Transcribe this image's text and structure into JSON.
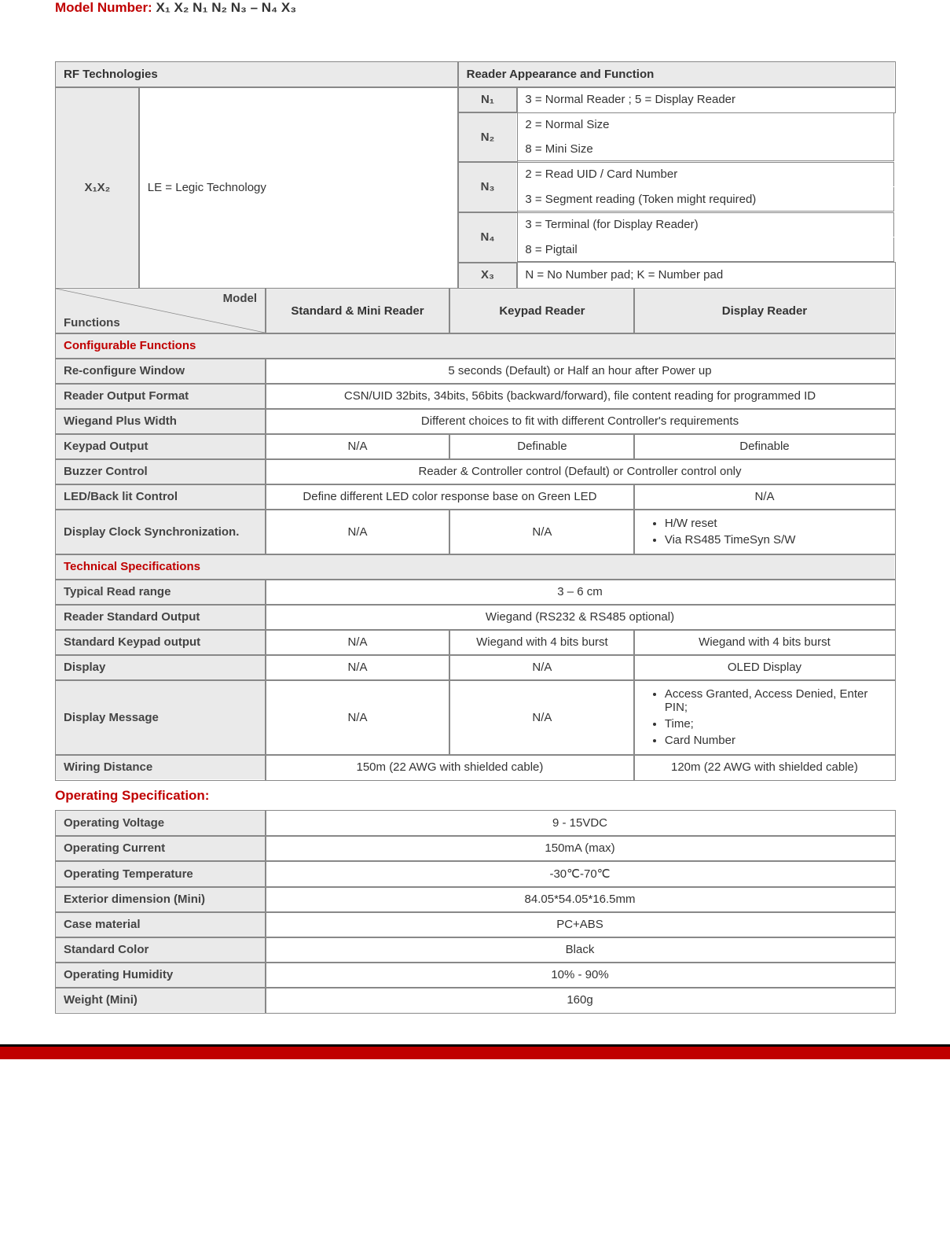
{
  "title_prefix": "Model Number: ",
  "title_model": "X₁ X₂ N₁ N₂ N₃ – N₄ X₃",
  "top": {
    "h1": "RF Technologies",
    "h2": "Reader Appearance and Function",
    "x1x2_label": "X₁X₂",
    "x1x2_val": "LE = Legic Technology",
    "rows": [
      {
        "k": "N₁",
        "v": "3 = Normal Reader ; 5 = Display Reader"
      },
      {
        "k": "N₂",
        "v1": "2 = Normal Size",
        "v2": "8 = Mini Size"
      },
      {
        "k": "N₃",
        "v1": "2 = Read UID / Card Number",
        "v2": "3 = Segment reading (Token might required)"
      },
      {
        "k": "N₄",
        "v1": "3 = Terminal (for Display Reader)",
        "v2": "8 = Pigtail"
      },
      {
        "k": "X₃",
        "v": "N = No Number pad; K = Number pad"
      }
    ]
  },
  "colhdr": {
    "model": "Model",
    "functions": "Functions",
    "c1": "Standard & Mini Reader",
    "c2": "Keypad Reader",
    "c3": "Display Reader"
  },
  "configurable": {
    "title": "Configurable Functions",
    "rows": [
      {
        "label": "Re-configure Window",
        "span": "5 seconds (Default) or Half an hour after Power up"
      },
      {
        "label": "Reader Output Format",
        "span": "CSN/UID 32bits, 34bits, 56bits (backward/forward), file content reading for programmed ID"
      },
      {
        "label": "Wiegand Plus Width",
        "span": "Different choices to fit with different Controller's requirements"
      },
      {
        "label": "Keypad Output",
        "c1": "N/A",
        "c2": "Definable",
        "c3": "Definable"
      },
      {
        "label": "Buzzer Control",
        "span": "Reader & Controller control (Default) or Controller control only"
      },
      {
        "label": "LED/Back lit Control",
        "c12": "Define different LED color response base on Green LED",
        "c3": "N/A"
      },
      {
        "label": "Display Clock Synchronization.",
        "c1": "N/A",
        "c2": "N/A",
        "list": [
          "H/W reset",
          "Via RS485 TimeSyn S/W"
        ]
      }
    ]
  },
  "tech": {
    "title": "Technical Specifications",
    "rows": [
      {
        "label": "Typical Read range",
        "span": "3 – 6 cm"
      },
      {
        "label": "Reader Standard Output",
        "span": "Wiegand (RS232 & RS485 optional)"
      },
      {
        "label": "Standard Keypad output",
        "c1": "N/A",
        "c2": "Wiegand with 4 bits burst",
        "c3": "Wiegand with 4 bits burst"
      },
      {
        "label": "Display",
        "c1": "N/A",
        "c2": "N/A",
        "c3": "OLED Display"
      },
      {
        "label": "Display Message",
        "c1": "N/A",
        "c2": "N/A",
        "list": [
          "Access Granted, Access Denied, Enter PIN;",
          "Time;",
          "Card Number"
        ]
      },
      {
        "label": "Wiring Distance",
        "c12": "150m (22 AWG with shielded cable)",
        "c3": "120m (22 AWG with shielded cable)"
      }
    ]
  },
  "op": {
    "title": "Operating Specification:",
    "rows": [
      {
        "label": "Operating Voltage",
        "val": "9 - 15VDC"
      },
      {
        "label": "Operating Current",
        "val": "150mA (max)"
      },
      {
        "label": "Operating Temperature",
        "val": "-30℃-70℃"
      },
      {
        "label": "Exterior dimension (Mini)",
        "val": "84.05*54.05*16.5mm"
      },
      {
        "label": "Case material",
        "val": "PC+ABS"
      },
      {
        "label": "Standard Color",
        "val": "Black"
      },
      {
        "label": "Operating Humidity",
        "val": "10% - 90%"
      },
      {
        "label": "Weight (Mini)",
        "val": "160g"
      }
    ]
  }
}
